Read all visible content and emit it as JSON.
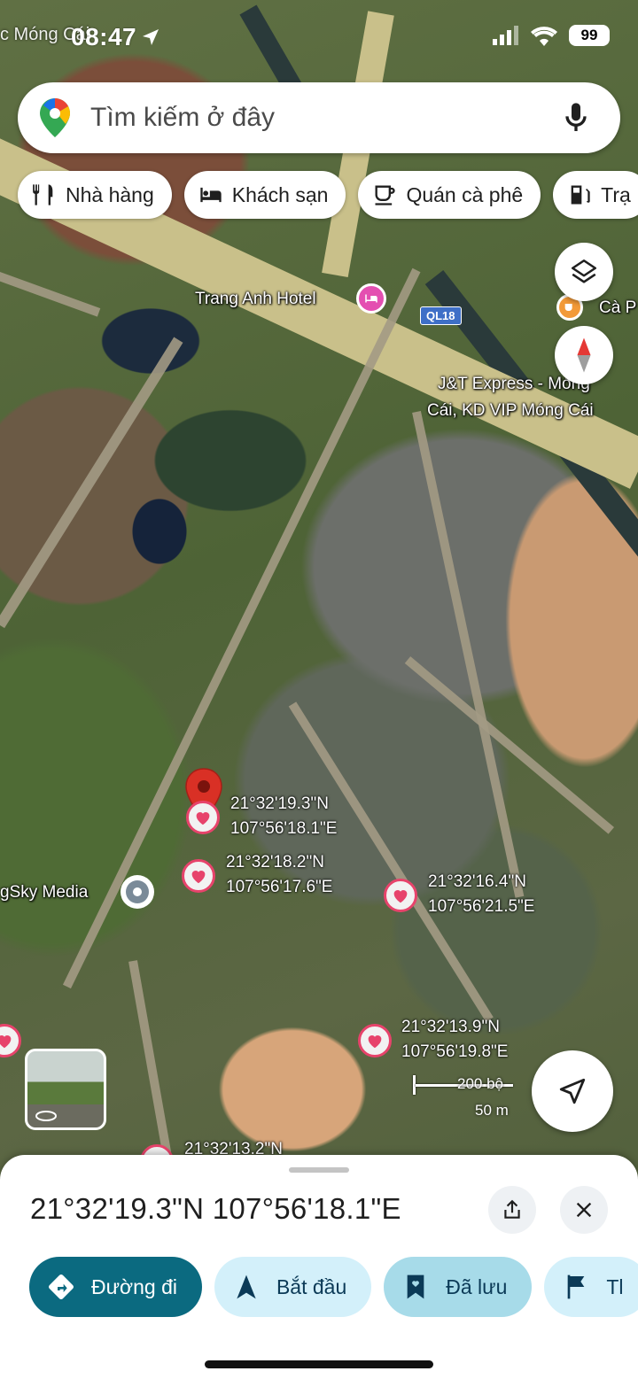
{
  "status_bar": {
    "time": "08:47",
    "place_fragment": "c Móng Cái",
    "battery": "99"
  },
  "search": {
    "placeholder": "Tìm kiếm ở đây"
  },
  "chips": [
    {
      "label": "Nhà hàng",
      "icon": "fork-knife-icon"
    },
    {
      "label": "Khách sạn",
      "icon": "bed-icon"
    },
    {
      "label": "Quán cà phê",
      "icon": "coffee-cup-icon"
    },
    {
      "label": "Trạ",
      "icon": "gas-station-icon"
    }
  ],
  "map": {
    "labels": {
      "hotel": "Trang Anh Hotel",
      "cafe": "Cà P",
      "jt_line1": "J&T Express - Móng",
      "jt_line2": "Cái, KD VIP Móng Cái",
      "media": "gSky Media",
      "road": "QL18"
    },
    "saved_points": [
      {
        "lat": "21°32'19.3\"N",
        "lon": "107°56'18.1\"E"
      },
      {
        "lat": "21°32'18.2\"N",
        "lon": "107°56'17.6\"E"
      },
      {
        "lat": "21°32'16.4\"N",
        "lon": "107°56'21.5\"E"
      },
      {
        "lat": "21°32'13.9\"N",
        "lon": "107°56'19.8\"E"
      },
      {
        "lat": "21°32'13.2\"N"
      }
    ],
    "scale": {
      "feet": "200 bộ",
      "meters": "50 m"
    },
    "accent": "#e7436b",
    "pin_color": "#d93025"
  },
  "sheet": {
    "title": "21°32'19.3\"N 107°56'18.1\"E",
    "actions": [
      {
        "label": "Đường đi",
        "icon": "directions-icon"
      },
      {
        "label": "Bắt đầu",
        "icon": "navigation-arrow-icon"
      },
      {
        "label": "Đã lưu",
        "icon": "bookmark-icon"
      },
      {
        "label": "Tl",
        "icon": "flag-icon"
      }
    ]
  }
}
